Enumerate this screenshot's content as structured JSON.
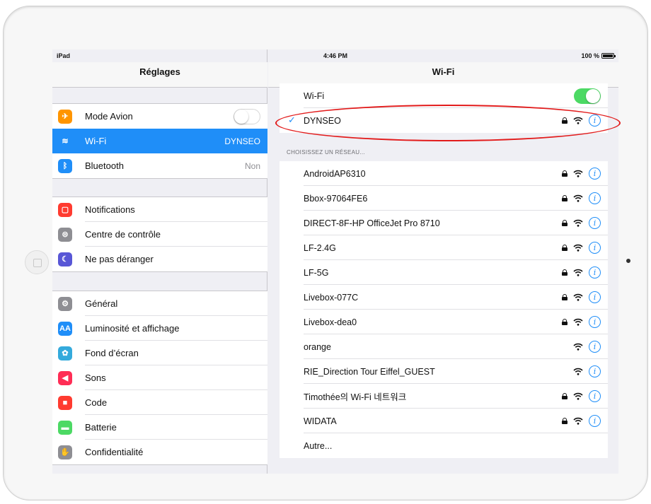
{
  "status": {
    "device": "iPad",
    "time": "4:46 PM",
    "battery": "100 %"
  },
  "left": {
    "title": "Réglages",
    "group1": [
      {
        "label": "Mode Avion",
        "icon": "airplane-icon",
        "color": "#ff9500",
        "toggle": "off"
      },
      {
        "label": "Wi-Fi",
        "value": "DYNSEO",
        "icon": "wifi-icon",
        "color": "#1f8ef8",
        "selected": true
      },
      {
        "label": "Bluetooth",
        "value": "Non",
        "icon": "bluetooth-icon",
        "color": "#1f8ef8"
      }
    ],
    "group2": [
      {
        "label": "Notifications",
        "icon": "notifications-icon",
        "color": "#ff3b30"
      },
      {
        "label": "Centre de contrôle",
        "icon": "control-center-icon",
        "color": "#8e8e93"
      },
      {
        "label": "Ne pas déranger",
        "icon": "moon-icon",
        "color": "#5856d6"
      }
    ],
    "group3": [
      {
        "label": "Général",
        "icon": "gear-icon",
        "color": "#8e8e93"
      },
      {
        "label": "Luminosité et affichage",
        "icon": "brightness-icon",
        "color": "#1f8ef8",
        "glyph": "AA"
      },
      {
        "label": "Fond d’écran",
        "icon": "wallpaper-icon",
        "color": "#34aadc"
      },
      {
        "label": "Sons",
        "icon": "speaker-icon",
        "color": "#ff2d55"
      },
      {
        "label": "Code",
        "icon": "lock-icon",
        "color": "#ff3b30"
      },
      {
        "label": "Batterie",
        "icon": "battery-icon",
        "color": "#4cd964"
      },
      {
        "label": "Confidentialité",
        "icon": "hand-icon",
        "color": "#8e8e93"
      }
    ]
  },
  "right": {
    "title": "Wi-Fi",
    "wifi_label": "Wi-Fi",
    "wifi_toggle": "on",
    "connected": "DYNSEO",
    "section_header": "CHOISISSEZ UN RÉSEAU...",
    "networks": [
      {
        "name": "AndroidAP6310",
        "locked": true
      },
      {
        "name": "Bbox-97064FE6",
        "locked": true
      },
      {
        "name": "DIRECT-8F-HP OfficeJet Pro 8710",
        "locked": true
      },
      {
        "name": "LF-2.4G",
        "locked": true
      },
      {
        "name": "LF-5G",
        "locked": true
      },
      {
        "name": "Livebox-077C",
        "locked": true
      },
      {
        "name": "Livebox-dea0",
        "locked": true
      },
      {
        "name": "orange",
        "locked": false
      },
      {
        "name": "RIE_Direction Tour Eiffel_GUEST",
        "locked": false
      },
      {
        "name": "Timothée의 Wi-Fi 네트워크",
        "locked": true
      },
      {
        "name": "WIDATA",
        "locked": true
      }
    ],
    "other": "Autre...",
    "info_glyph": "i",
    "check_glyph": "✓"
  },
  "colors": {
    "accent": "#1f8ef8",
    "toggle_on": "#4cd964",
    "highlight": "#e21b1b"
  }
}
